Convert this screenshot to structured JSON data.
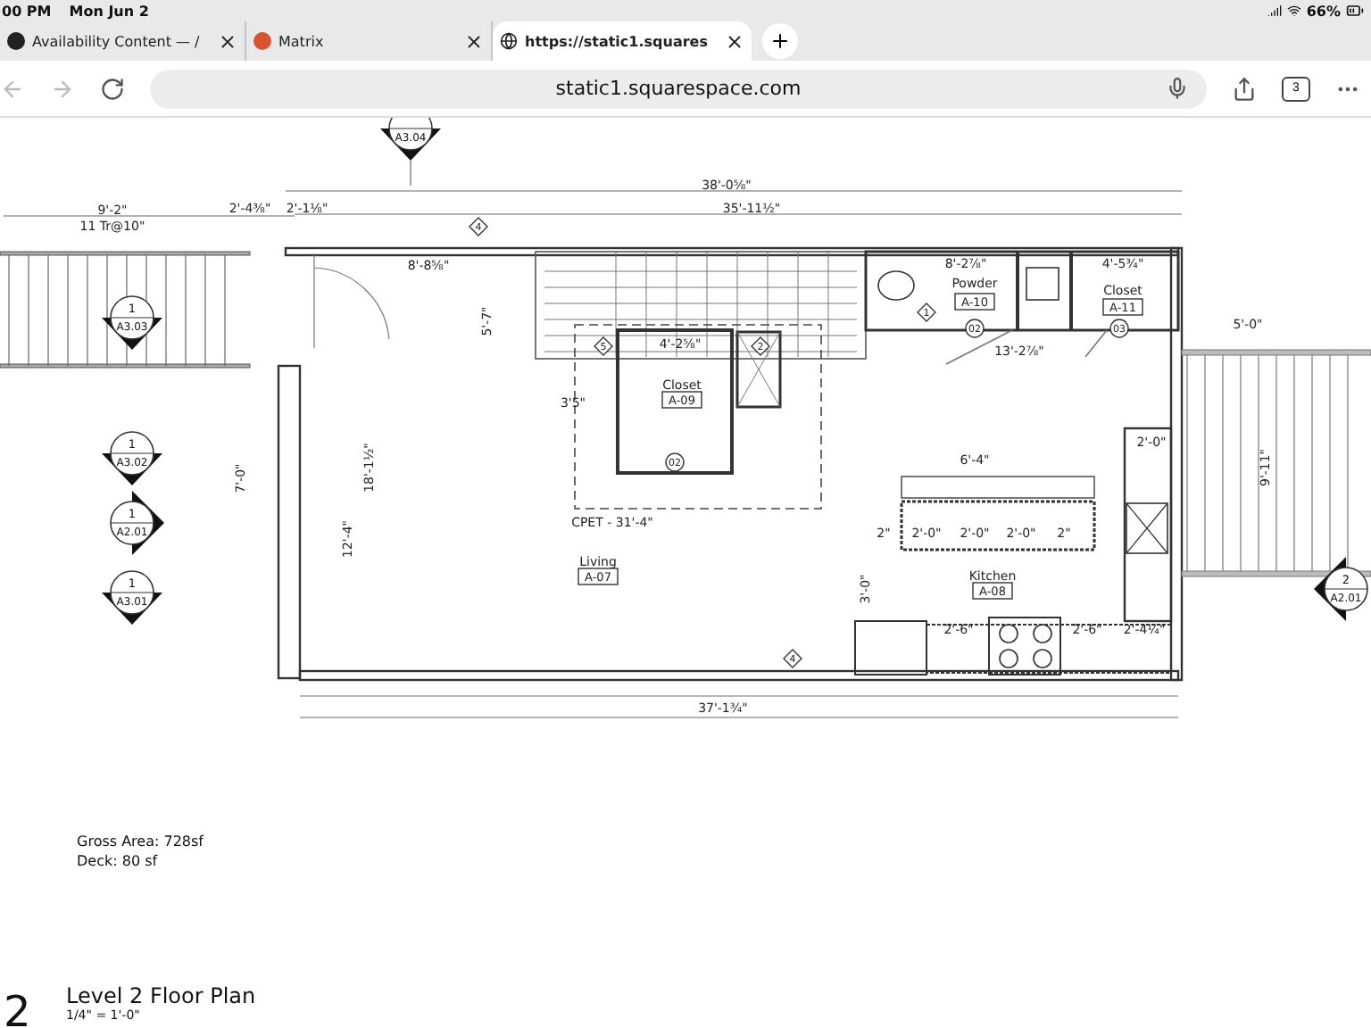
{
  "status_bar": {
    "time": "00 PM",
    "date": "Mon Jun 2",
    "battery": "66%"
  },
  "tabs": [
    {
      "title": "Availability Content — /",
      "kind": "dark",
      "selected": false
    },
    {
      "title": "Matrix",
      "kind": "orange",
      "selected": false
    },
    {
      "title": "https://static1.squares",
      "kind": "globe",
      "selected": true
    }
  ],
  "address_bar": {
    "url": "static1.squarespace.com",
    "tab_count": "3"
  },
  "plan": {
    "labels": [
      {
        "text": "9'-2\"",
        "kind": "dim"
      },
      {
        "text": "11 Tr@10\"",
        "kind": "dim"
      },
      {
        "text": "2'-4⅜\"",
        "kind": "dim"
      },
      {
        "text": "2'-1⅛\"",
        "kind": "dim"
      },
      {
        "text": "38'-0⅝\"",
        "kind": "dim"
      },
      {
        "text": "35'-11½\"",
        "kind": "dim"
      },
      {
        "text": "8'-8⅝\"",
        "kind": "dim"
      },
      {
        "text": "8'-2⅞\"",
        "kind": "dim"
      },
      {
        "text": "4'-5¾\"",
        "kind": "dim"
      },
      {
        "text": "Powder",
        "kind": "room"
      },
      {
        "text": "A-10",
        "kind": "tag"
      },
      {
        "text": "Closet",
        "kind": "room"
      },
      {
        "text": "A-11",
        "kind": "tag"
      },
      {
        "text": "02",
        "kind": "circle"
      },
      {
        "text": "03",
        "kind": "circle"
      },
      {
        "text": "13'-2⅞\"",
        "kind": "dim"
      },
      {
        "text": "5'-0\"",
        "kind": "dim"
      },
      {
        "text": "4'-2⅝\"",
        "kind": "dim"
      },
      {
        "text": "Closet",
        "kind": "room"
      },
      {
        "text": "A-09",
        "kind": "tag"
      },
      {
        "text": "02",
        "kind": "circle"
      },
      {
        "text": "5",
        "kind": "diamond"
      },
      {
        "text": "2",
        "kind": "diamond"
      },
      {
        "text": "3'5\"",
        "kind": "dim"
      },
      {
        "text": "CPET - 31'-4\"",
        "kind": "dim"
      },
      {
        "text": "Living",
        "kind": "room"
      },
      {
        "text": "A-07",
        "kind": "tag"
      },
      {
        "text": "6'-4\"",
        "kind": "dim"
      },
      {
        "text": "2\"",
        "kind": "dim"
      },
      {
        "text": "2'-0\"",
        "kind": "dim"
      },
      {
        "text": "2'-0\"",
        "kind": "dim"
      },
      {
        "text": "2'-0\"",
        "kind": "dim"
      },
      {
        "text": "2\"",
        "kind": "dim"
      },
      {
        "text": "Kitchen",
        "kind": "room"
      },
      {
        "text": "A-08",
        "kind": "tag"
      },
      {
        "text": "2'-0\"",
        "kind": "dim"
      },
      {
        "text": "2'-6\"",
        "kind": "dim"
      },
      {
        "text": "2'-6\"",
        "kind": "dim"
      },
      {
        "text": "2'-4¼\"",
        "kind": "dim"
      },
      {
        "text": "4",
        "kind": "diamond"
      },
      {
        "text": "4",
        "kind": "diamond"
      },
      {
        "text": "37'-1¾\"",
        "kind": "dim"
      },
      {
        "text": "18'-1½\"",
        "kind": "dim"
      },
      {
        "text": "12'-4\"",
        "kind": "dim"
      },
      {
        "text": "7'-0\"",
        "kind": "dim"
      },
      {
        "text": "5'-7\"",
        "kind": "dim"
      },
      {
        "text": "9'-11\"",
        "kind": "dim"
      },
      {
        "text": "3'-0\"",
        "kind": "dim"
      },
      {
        "text": "1",
        "kind": "diamond"
      }
    ],
    "section_markers": [
      {
        "sheet": "A3.04",
        "kind": "down"
      },
      {
        "number": "1",
        "sheet": "A3.03",
        "kind": "down"
      },
      {
        "number": "1",
        "sheet": "A3.02",
        "kind": "down"
      },
      {
        "number": "1",
        "sheet": "A2.01",
        "kind": "right"
      },
      {
        "number": "1",
        "sheet": "A3.01",
        "kind": "down"
      },
      {
        "number": "2",
        "sheet": "A2.01",
        "kind": "left"
      }
    ],
    "notes": [
      "Gross Area: 728sf",
      "Deck: 80 sf"
    ],
    "title": {
      "number": "2",
      "name": "Level 2 Floor Plan",
      "scale": "1/4\" = 1'-0\""
    }
  }
}
